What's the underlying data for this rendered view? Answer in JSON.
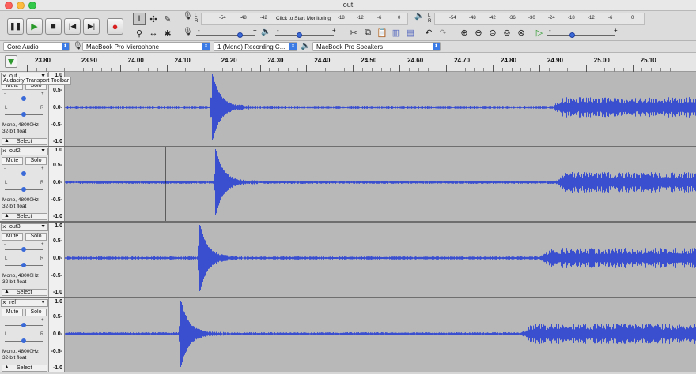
{
  "window": {
    "title": "out"
  },
  "transport": {
    "buttons": [
      "pause-icon",
      "play-icon",
      "stop-icon",
      "skip-start-icon",
      "skip-end-icon",
      "record-icon"
    ],
    "tooltip": "Audacity Transport Toolbar"
  },
  "record_meter": {
    "channel_top": "L",
    "channel_bottom": "R",
    "ticks": [
      "-54",
      "-48",
      "-42"
    ],
    "hint": "Click to Start Monitoring",
    "ticks_after": [
      "-18",
      "-12",
      "-6",
      "0"
    ]
  },
  "playback_meter": {
    "channel_top": "L",
    "channel_bottom": "R",
    "ticks": [
      "-54",
      "-48",
      "-42",
      "-36",
      "-30",
      "-24",
      "-18",
      "-12",
      "-6",
      "0"
    ]
  },
  "mixer": {
    "record_volume": {
      "minus": "-",
      "plus": "+"
    },
    "playback_volume": {
      "minus": "-",
      "plus": "+"
    }
  },
  "play_at_speed": {
    "minus": "-",
    "plus": "+"
  },
  "devices": {
    "host": "Core Audio",
    "input": "MacBook Pro Microphone",
    "channels": "1 (Mono) Recording C...",
    "output": "MacBook Pro Speakers"
  },
  "timeline": {
    "ticks": [
      "23.80",
      "23.90",
      "24.00",
      "24.10",
      "24.20",
      "24.30",
      "24.40",
      "24.50",
      "24.60",
      "24.70",
      "24.80",
      "24.90",
      "25.00",
      "25.10"
    ]
  },
  "tracks": [
    {
      "name": "out",
      "mute": "Mute",
      "solo": "Solo",
      "format_line1": "Mono, 48000Hz",
      "format_line2": "32-bit float",
      "select": "Select",
      "gain_minus": "-",
      "gain_plus": "+",
      "pan_left": "L",
      "pan_right": "R",
      "scale": [
        "1.0",
        "0.5-",
        "0.0-",
        "-0.5-",
        "-1.0"
      ],
      "color": "#3a4fd0"
    },
    {
      "name": "out2",
      "mute": "Mute",
      "solo": "Solo",
      "format_line1": "Mono, 48000Hz",
      "format_line2": "32-bit float",
      "select": "Select",
      "gain_minus": "-",
      "gain_plus": "+",
      "pan_left": "L",
      "pan_right": "R",
      "scale": [
        "1.0",
        "0.5-",
        "0.0-",
        "-0.5-",
        "-1.0"
      ],
      "color": "#3a4fd0"
    },
    {
      "name": "out3",
      "mute": "Mute",
      "solo": "Solo",
      "format_line1": "Mono, 48000Hz",
      "format_line2": "32-bit float",
      "select": "Select",
      "gain_minus": "-",
      "gain_plus": "+",
      "pan_left": "L",
      "pan_right": "R",
      "scale": [
        "1.0",
        "0.5-",
        "0.0-",
        "-0.5-",
        "-1.0"
      ],
      "color": "#3a4fd0"
    },
    {
      "name": "ref",
      "mute": "Mute",
      "solo": "Solo",
      "format_line1": "Mono, 48000Hz",
      "format_line2": "32-bit float",
      "select": "Select",
      "gain_minus": "-",
      "gain_plus": "+",
      "pan_left": "L",
      "pan_right": "R",
      "scale": [
        "1.0",
        "0.5-",
        "0.0-",
        "-0.5-",
        "-1.0"
      ],
      "color": "#3a4fd0"
    }
  ]
}
